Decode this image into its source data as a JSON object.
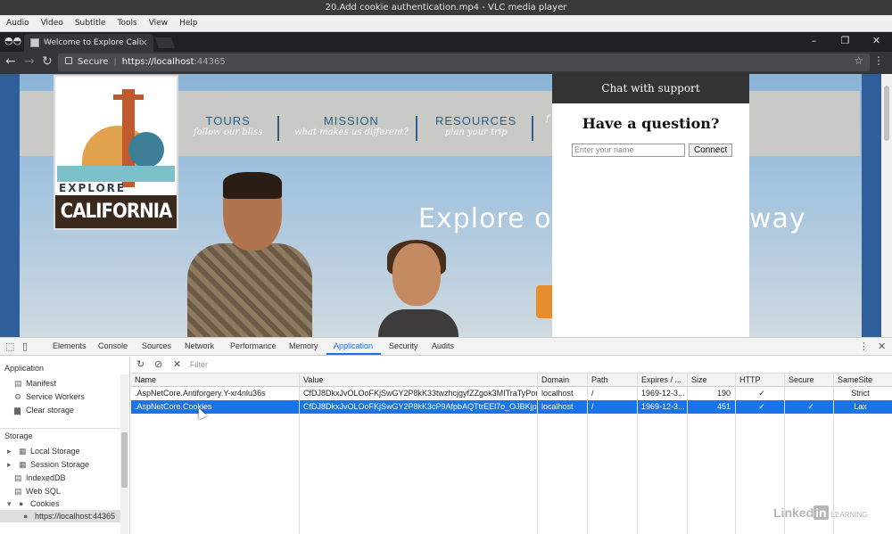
{
  "window": {
    "title": "20.Add cookie authentication.mp4 - VLC media player"
  },
  "vlc_menu": [
    "Audio",
    "Video",
    "Subtitle",
    "Tools",
    "View",
    "Help"
  ],
  "browser": {
    "tab_title": "Welcome to Explore Cali",
    "security_label": "Secure",
    "url_host": "https://localhost",
    "url_port": ":44365"
  },
  "site": {
    "logo_line1": "EXPLORE",
    "logo_line2": "CALIFORNIA",
    "nav": [
      {
        "title": "TOURS",
        "subtitle": "follow our bliss"
      },
      {
        "title": "MISSION",
        "subtitle": "what makes us different?"
      },
      {
        "title": "RESOURCES",
        "subtitle": "plan your trip"
      },
      {
        "title": "",
        "subtitle": "f"
      }
    ],
    "hero_left": "Explore ou",
    "hero_right": "way"
  },
  "chat": {
    "header": "Chat with support",
    "question": "Have a question?",
    "name_placeholder": "Enter your name",
    "connect_label": "Connect"
  },
  "devtools": {
    "tabs": [
      "Elements",
      "Console",
      "Sources",
      "Network",
      "Performance",
      "Memory",
      "Application",
      "Security",
      "Audits"
    ],
    "active_tab": "Application",
    "sidebar": {
      "application_heading": "Application",
      "application_items": [
        "Manifest",
        "Service Workers",
        "Clear storage"
      ],
      "storage_heading": "Storage",
      "storage_items": [
        "Local Storage",
        "Session Storage",
        "IndexedDB",
        "Web SQL",
        "Cookies"
      ],
      "cookie_origin": "https://localhost:44365"
    },
    "filter_placeholder": "Filter",
    "columns": [
      "Name",
      "Value",
      "Domain",
      "Path",
      "Expires / ...",
      "Size",
      "HTTP",
      "Secure",
      "SameSite"
    ],
    "rows": [
      {
        "name": ".AspNetCore.Antiforgery.Y-xr4nlu36s",
        "value": "CfDJ8DkxJvOLOoFKjSwGY2P8kK33twzhcjgyfZZgok3MITraTyPom9...",
        "domain": "localhost",
        "path": "/",
        "expires": "1969-12-3...",
        "size": "190",
        "http": "✓",
        "secure": "",
        "samesite": "Strict",
        "selected": false
      },
      {
        "name": ".AspNetCore.Cookies",
        "value": "CfDJ8DkxJvOLOoFKjSwGY2P8kK3cP9AfpbAQTtrEEl7o_OJBKjpIceh...",
        "domain": "localhost",
        "path": "/",
        "expires": "1969-12-3...",
        "size": "451",
        "http": "✓",
        "secure": "✓",
        "samesite": "Lax",
        "selected": true
      }
    ]
  },
  "watermark": {
    "brand": "Linked",
    "in": "in",
    "suffix": "LEARNING"
  },
  "colors": {
    "accent": "#1a73e8",
    "nav_text": "#2b5d8c",
    "chat_header": "#333333"
  }
}
